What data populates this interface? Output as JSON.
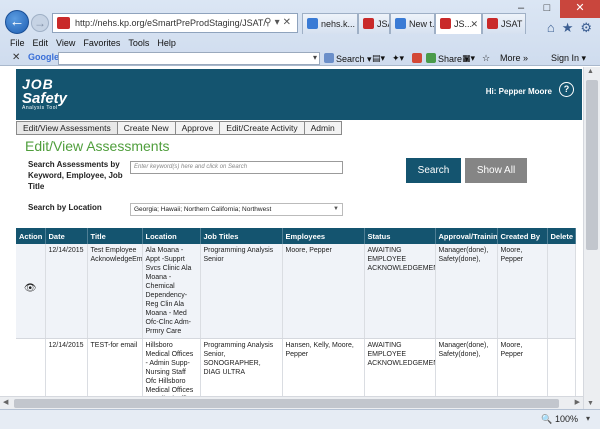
{
  "browser": {
    "url": "http://nehs.kp.org/eSmartPreProdStaging/JSAT/",
    "tabs": [
      {
        "label": "nehs.k...",
        "color": "#3a7bd5"
      },
      {
        "label": "JSAT",
        "color": "#c92a2a"
      },
      {
        "label": "New t...",
        "color": "#3a7bd5"
      },
      {
        "label": "JS...",
        "color": "#c92a2a"
      },
      {
        "label": "JSAT",
        "color": "#c92a2a"
      }
    ],
    "menu": [
      "File",
      "Edit",
      "View",
      "Favorites",
      "Tools",
      "Help"
    ],
    "google_label": "Google",
    "toolbar": {
      "search": "Search",
      "share": "Share",
      "more": "More »",
      "signin": "Sign In"
    },
    "zoom": "100%"
  },
  "app": {
    "logo": {
      "line1": "JOB",
      "line2": "Safety",
      "line3": "Analysis Tool"
    },
    "greeting": "Hi: Pepper Moore",
    "help": "?",
    "nav_tabs": [
      "Edit/View Assessments",
      "Create New",
      "Approve",
      "Edit/Create Activity",
      "Admin"
    ],
    "page_title": "Edit/View Assessments",
    "search_label": "Search Assessments by Keyword, Employee, Job Title",
    "search_placeholder": "Enter keyword(s) here and click on Search",
    "search_button": "Search",
    "show_all_button": "Show All",
    "location_label": "Search by Location",
    "location_value": "Georgia; Hawaii; Northern California; Northwest",
    "table": {
      "headers": [
        "Action",
        "Date",
        "Title",
        "Location",
        "Job Titles",
        "Employees",
        "Status",
        "Approval/Training",
        "Created By",
        "Delete"
      ],
      "rows": [
        {
          "action_icon": "eye-icon",
          "date": "12/14/2015",
          "title": "Test Employee AcknowledgeEm",
          "location": "Ala Moana - Appt -Supprt Svcs Clinic Ala Moana - Chemical Dependency-Reg Clin Ala Moana - Med Ofc-Clnc Adm-Prmry Care",
          "job_titles": "Programming Analysis Senior",
          "employees": "Moore, Pepper",
          "status": "AWAITING EMPLOYEE ACKNOWLEDGEMENT",
          "approval": "Manager(done), Safety(done),",
          "created_by": "Moore, Pepper"
        },
        {
          "action_icon": "",
          "date": "12/14/2015",
          "title": "TEST-for email",
          "location": "Hillsboro Medical Offices - Admin Supp-Nursing Staff Ofc Hillsboro Medical Offices - Medical Office",
          "job_titles": "Programming Analysis Senior, SONOGRAPHER, DIAG ULTRA",
          "employees": "Hansen, Kelly, Moore, Pepper",
          "status": "AWAITING EMPLOYEE ACKNOWLEDGEMENT",
          "approval": "Manager(done), Safety(done),",
          "created_by": "Moore, Pepper"
        }
      ]
    }
  }
}
